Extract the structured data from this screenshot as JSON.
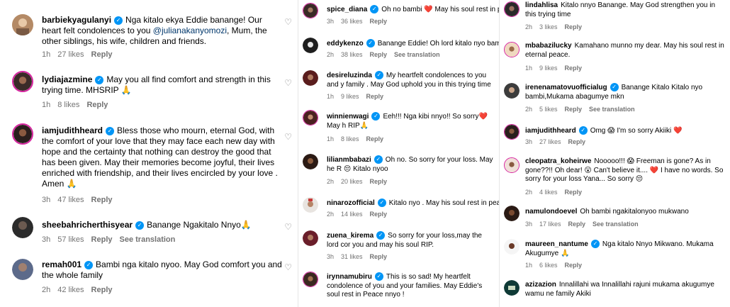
{
  "col1": [
    {
      "user": "barbiekyagulanyi",
      "text_a": "Nga kitalo ekya Eddie banange! Our heart felt condolences to you ",
      "mention": "@julianakanyomozi",
      "text_b": ", Mum, the other siblings, his wife, children and friends.",
      "time": "1h",
      "likes": "27 likes",
      "reply": "Reply"
    },
    {
      "user": "lydiajazmine",
      "text": "May you all find comfort and strength in this trying time. MHSRIP 🙏",
      "time": "1h",
      "likes": "8 likes",
      "reply": "Reply"
    },
    {
      "user": "iamjudithheard",
      "text": "Bless those who mourn, eternal God, with the comfort of your love that they may face each new day with hope and the certainty that nothing can destroy the good that has been given. May their memories become joyful, their lives enriched with friendship, and their lives encircled by your love . Amen 🙏",
      "time": "3h",
      "likes": "47 likes",
      "reply": "Reply"
    },
    {
      "user": "sheebahricherthisyear",
      "text": "Banange Ngakitalo Nnyo🙏",
      "time": "3h",
      "likes": "57 likes",
      "reply": "Reply",
      "see": "See translation"
    },
    {
      "user": "remah001",
      "text": "Bambi nga kitalo nyoo. May God comfort you and the whole family",
      "time": "2h",
      "likes": "42 likes",
      "reply": "Reply"
    }
  ],
  "col2": [
    {
      "user": "spice_diana",
      "text": "Oh no bambi ❤️ May his soul rest in pe",
      "time": "3h",
      "likes": "36 likes",
      "reply": "Reply"
    },
    {
      "user": "eddykenzo",
      "text": "Banange Eddie! Oh lord kitalo nyo bamb",
      "time": "2h",
      "likes": "38 likes",
      "reply": "Reply",
      "see": "See translation"
    },
    {
      "user": "desireluzinda",
      "text": "My heartfelt condolences to you and y family . May God uphold you in this trying time",
      "time": "1h",
      "likes": "9 likes",
      "reply": "Reply"
    },
    {
      "user": "winnienwagi",
      "text": "Eeh!!! Nga kibi nnyo!! So sorry❤️ May h RIP🙏",
      "time": "1h",
      "likes": "8 likes",
      "reply": "Reply"
    },
    {
      "user": "lilianmbabazi",
      "text": "Oh no. So sorry for your loss. May he R 😔 Kitalo nyoo",
      "time": "2h",
      "likes": "20 likes",
      "reply": "Reply"
    },
    {
      "user": "ninarozofficial",
      "text": "Kitalo nyo . May his soul rest in peace",
      "time": "2h",
      "likes": "14 likes",
      "reply": "Reply"
    },
    {
      "user": "zuena_kirema",
      "text": "So sorry for your loss,may the lord cor you and may his soul RIP.",
      "time": "3h",
      "likes": "31 likes",
      "reply": "Reply"
    },
    {
      "user": "irynnamubiru",
      "text": "This is so sad! My heartfelt condolence of you and your families. May Eddie's soul rest in Peace nnyo !"
    }
  ],
  "col3": [
    {
      "user": "lindahlisa",
      "text": "Kitalo nnyo Banange. May God strengthen you in this trying time",
      "time": "2h",
      "likes": "3 likes",
      "reply": "Reply"
    },
    {
      "user": "mbabazilucky",
      "text": "Kamahano munno my dear. May his soul rest in eternal peace.",
      "time": "1h",
      "likes": "9 likes",
      "reply": "Reply"
    },
    {
      "user": "irenenamatovuofficialug",
      "text": "Banange Kitalo Kitalo nyo bambi,Mukama abagumye mkn",
      "time": "2h",
      "likes": "5 likes",
      "reply": "Reply",
      "see": "See translation"
    },
    {
      "user": "iamjudithheard",
      "text": "Omg 😱 I'm so sorry Akiiki ❤️",
      "time": "3h",
      "likes": "27 likes",
      "reply": "Reply"
    },
    {
      "user": "cleopatra_koheirwe",
      "text": "Nooooo!!! 😱 Freeman is gone? As in gone??!! Oh dear! 😮 Can't believe it.... ❤️ I have no words. So sorry for your loss Yana... So sorry 😔",
      "time": "2h",
      "likes": "4 likes",
      "reply": "Reply"
    },
    {
      "user": "namulondoevel",
      "text": "Oh bambi ngakitalonyoo mukwano",
      "time": "3h",
      "likes": "17 likes",
      "reply": "Reply",
      "see": "See translation"
    },
    {
      "user": "maureen_nantume",
      "text": "Nga kitalo Nnyo Mikwano. Mukama Akugumye 🙏",
      "time": "1h",
      "likes": "6 likes",
      "reply": "Reply"
    },
    {
      "user": "azizazion",
      "text": "Innalillahi wa Innalillahi rajuni mukama akugumye wamu ne family Akiki"
    }
  ],
  "heart_icon": "heart-outline-icon",
  "verified_icon": "verified-badge-icon",
  "colors": {
    "verified": "#0095f6",
    "meta": "#737373",
    "mention": "#00376b"
  }
}
